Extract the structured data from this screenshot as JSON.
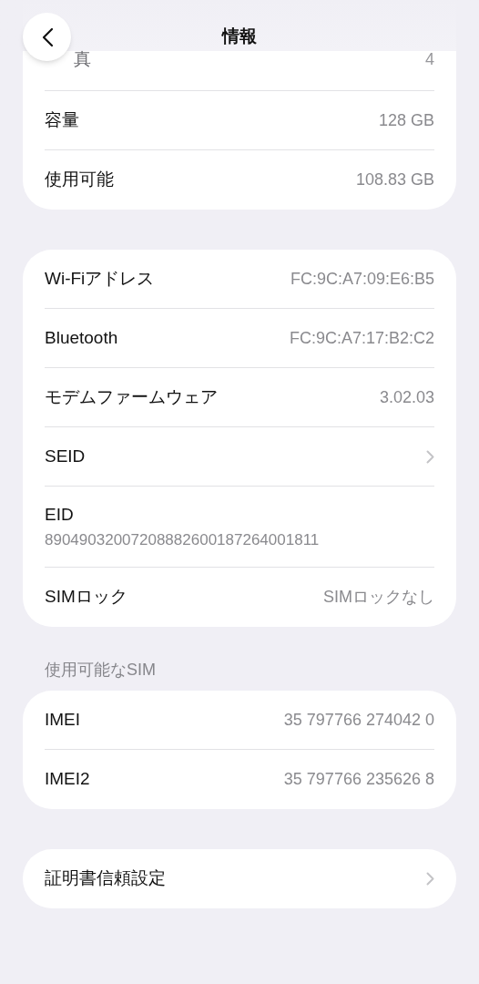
{
  "header": {
    "title": "情報"
  },
  "groups": [
    {
      "rows": [
        {
          "kind": "covered",
          "label": "真",
          "value": "4"
        },
        {
          "kind": "value",
          "label": "容量",
          "value": "128 GB"
        },
        {
          "kind": "value",
          "label": "使用可能",
          "value": "108.83 GB"
        }
      ]
    },
    {
      "rows": [
        {
          "kind": "value",
          "label": "Wi-Fiアドレス",
          "value": "FC:9C:A7:09:E6:B5"
        },
        {
          "kind": "value",
          "label": "Bluetooth",
          "value": "FC:9C:A7:17:B2:C2"
        },
        {
          "kind": "value",
          "label": "モデムファームウェア",
          "value": "3.02.03"
        },
        {
          "kind": "chevron",
          "label": "SEID"
        },
        {
          "kind": "stacked",
          "label": "EID",
          "value": "89049032007208882600187264001811"
        },
        {
          "kind": "value",
          "label": "SIMロック",
          "value": "SIMロックなし"
        }
      ]
    },
    {
      "section_title": "使用可能なSIM",
      "rows": [
        {
          "kind": "value",
          "label": "IMEI",
          "value": "35 797766 274042 0"
        },
        {
          "kind": "value",
          "label": "IMEI2",
          "value": "35 797766 235626 8"
        }
      ]
    },
    {
      "rows": [
        {
          "kind": "chevron",
          "label": "証明書信頼設定"
        }
      ]
    }
  ]
}
